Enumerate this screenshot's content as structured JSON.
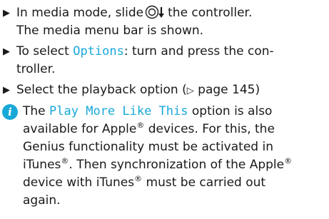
{
  "steps": [
    {
      "bullet": "▶",
      "part1": "In media mode, slide",
      "part2": "the controller.",
      "line2": "The media menu bar is shown."
    },
    {
      "bullet": "▶",
      "pre": "To select ",
      "highlight": "Options",
      "post": ": turn and press the con-",
      "line2": "troller."
    },
    {
      "bullet": "▶",
      "pre": "Select the playback option (",
      "ref_arrow": "▷",
      "ref": " page 145)"
    }
  ],
  "note": {
    "icon_label": "i",
    "pre": "The ",
    "highlight": "Play More Like This",
    "post": " option is also",
    "line2_pre": "available for Apple",
    "reg": "®",
    "line2_post": " devices. For this, the",
    "line3": "Genius functionality must be activated in",
    "line4_pre": "iTunes",
    "line4_post": ". Then synchronization of the Apple",
    "line5_pre": "device with iTunes",
    "line5_post": " must be carried out",
    "line6": "again."
  },
  "colors": {
    "accent": "#18a8d8",
    "text": "#1a1a1a"
  },
  "icons": {
    "controller": "controller-slide-down-icon",
    "info": "info-icon"
  }
}
